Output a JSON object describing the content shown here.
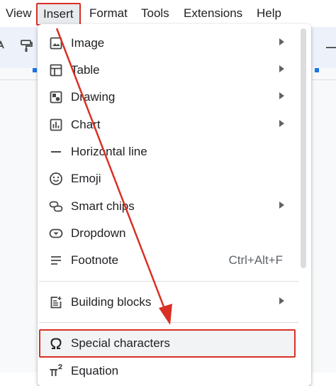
{
  "menubar": {
    "items": [
      {
        "label": "View"
      },
      {
        "label": "Insert"
      },
      {
        "label": "Format"
      },
      {
        "label": "Tools"
      },
      {
        "label": "Extensions"
      },
      {
        "label": "Help"
      }
    ],
    "active": "Insert"
  },
  "insert_menu": {
    "items": [
      {
        "label": "Image",
        "icon": "image-icon",
        "submenu": true
      },
      {
        "label": "Table",
        "icon": "table-icon",
        "submenu": true
      },
      {
        "label": "Drawing",
        "icon": "drawing-icon",
        "submenu": true
      },
      {
        "label": "Chart",
        "icon": "chart-icon",
        "submenu": true
      },
      {
        "label": "Horizontal line",
        "icon": "horizontal-line-icon",
        "submenu": false
      },
      {
        "label": "Emoji",
        "icon": "emoji-icon",
        "submenu": false
      },
      {
        "label": "Smart chips",
        "icon": "smart-chips-icon",
        "submenu": true
      },
      {
        "label": "Dropdown",
        "icon": "dropdown-icon",
        "submenu": false
      },
      {
        "label": "Footnote",
        "icon": "footnote-icon",
        "shortcut": "Ctrl+Alt+F"
      },
      {
        "label": "Building blocks",
        "icon": "building-blocks-icon",
        "submenu": true
      },
      {
        "label": "Special characters",
        "icon": "omega-icon",
        "submenu": false
      },
      {
        "label": "Equation",
        "icon": "pi-squared-icon",
        "submenu": false
      }
    ]
  },
  "colors": {
    "highlight_red": "#d93025",
    "toolbar_bg": "#edf2fa",
    "accent_blue": "#1a73e8"
  }
}
